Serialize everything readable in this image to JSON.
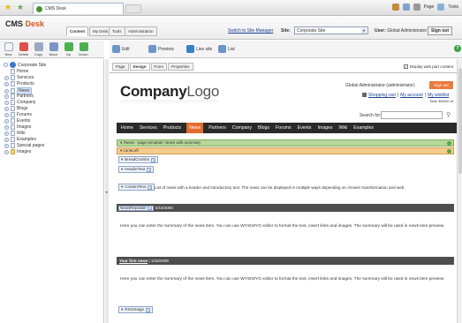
{
  "browser": {
    "tab_title": "CMS Desk",
    "tools": [
      "Page",
      "Tools"
    ]
  },
  "cms": {
    "logo_main": "CMS",
    "logo_desk": "Desk",
    "mode_tabs": [
      "Content",
      "My Desk",
      "Tools",
      "Administration"
    ],
    "switch_link": "Switch to Site Manager",
    "site_label": "Site:",
    "site_value": "Corporate Site",
    "user_label": "User:",
    "user_value": "Global Administrator",
    "signout": "Sign out"
  },
  "toolbar": {
    "buttons": [
      "New",
      "Delete",
      "Copy",
      "Move",
      "Up",
      "Down"
    ]
  },
  "editbar": {
    "edit": "Edit",
    "preview": "Preview",
    "live_site": "Live site",
    "list": "List"
  },
  "tree": {
    "root": "Corporate Site",
    "items": [
      "Home",
      "Services",
      "Products",
      "News",
      "Partners",
      "Company",
      "Blogs",
      "Forums",
      "Events",
      "Images",
      "Wiki",
      "Examples",
      "Special pages",
      "Images"
    ],
    "selected": "News"
  },
  "page_tabs": [
    "Page",
    "Design",
    "Form",
    "Properties"
  ],
  "display_web_part_content": "Display web part content",
  "site": {
    "logo_bold": "Company",
    "logo_light": "Logo",
    "user_text": "Global Administrator (administrator)",
    "signout": "Sign out",
    "shopping_cart": "Shopping cart",
    "my_account": "My account",
    "my_wishlist": "My wishlist",
    "total": "Total: $0050.15",
    "search_label": "Search for:",
    "nav": [
      "Home",
      "Services",
      "Products",
      "News",
      "Partners",
      "Company",
      "Blogs",
      "Forums",
      "Events",
      "Images",
      "Wiki",
      "Examples"
    ],
    "active_nav": "News"
  },
  "design": {
    "template_bar": "/News - page template: News with summary",
    "zone": "zoneLeft",
    "breadcrumbs": "BreadCrumbs",
    "header_text": "HeaderText",
    "content_text": "ContentText",
    "intro_text": "List of news with a header and introductory text. The news can be displayed in multiple ways depending on chosen transformation and web",
    "news_repeater": "NewsRepeater",
    "repeater_date": "5/16/2008",
    "summary_1": "Here you can enter the summary of the news item. You can use WYSIWYG editor to format the text, insert links and images. The summary will be used in news item preview.",
    "news_title": "Your first news",
    "news_date": "1/16/2008",
    "summary_2": "Here you can enter the summary of the news item. You can use WYSIWYG editor to format the text, insert links and images. The summary will be used in news item preview.",
    "rss_image": "RSSImage"
  }
}
